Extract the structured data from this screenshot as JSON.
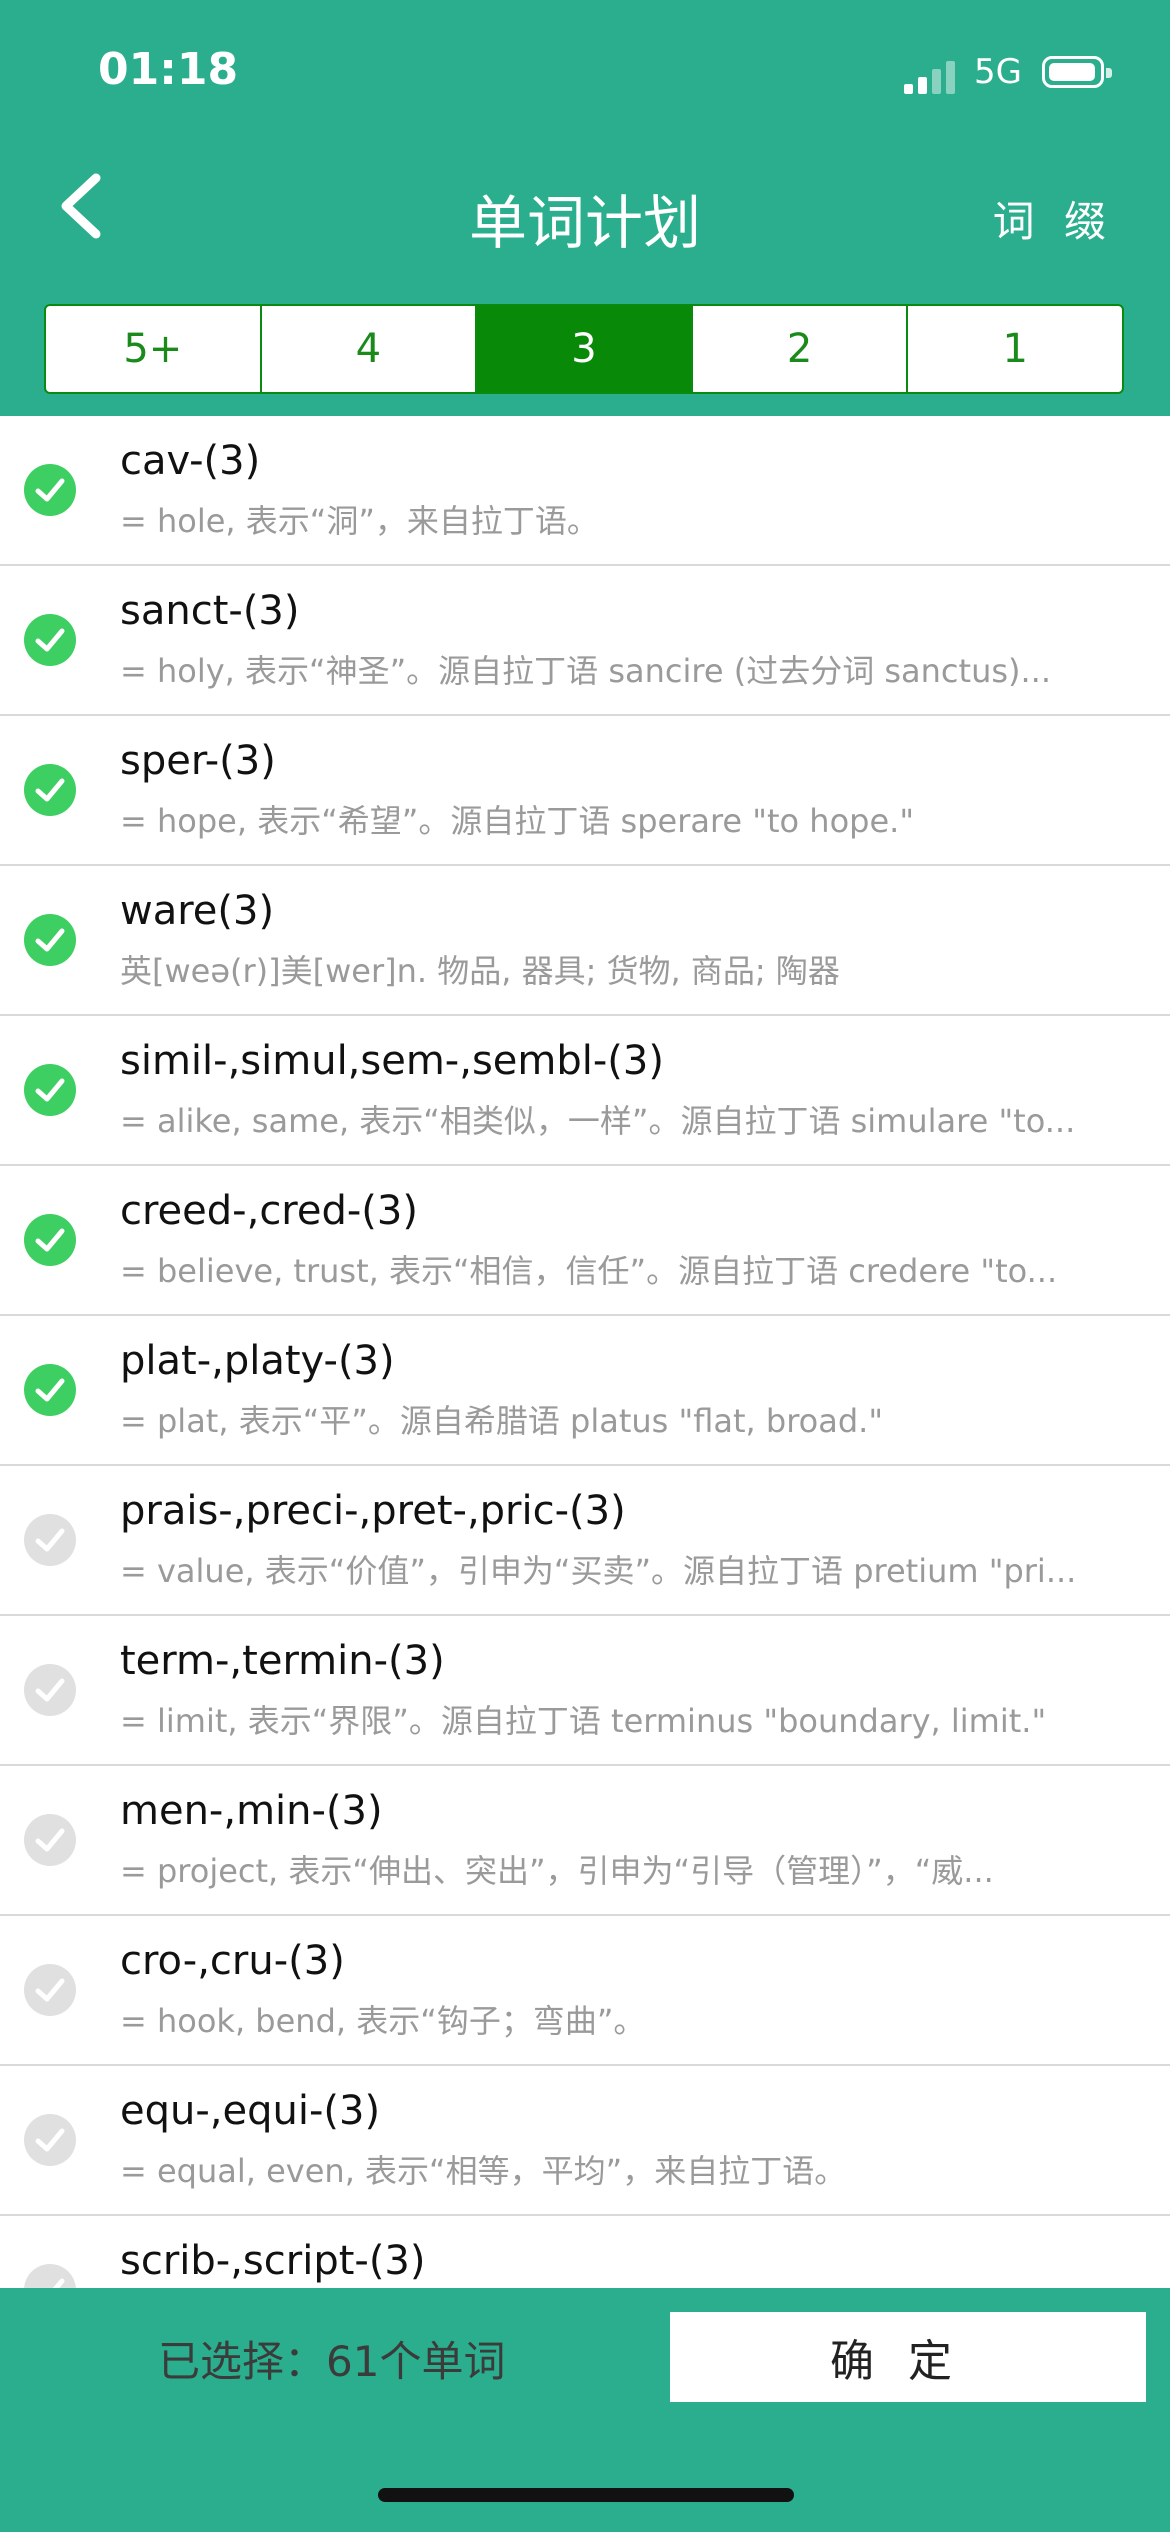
{
  "status_bar": {
    "time": "01:18",
    "network": "5G"
  },
  "header": {
    "title": "单词计划",
    "right_link": "词 缀",
    "segments": [
      "5+",
      "4",
      "3",
      "2",
      "1"
    ],
    "active_segment": "3"
  },
  "words": [
    {
      "word": "cav-(3)",
      "meaning": "= hole, 表示“洞”，来自拉丁语。",
      "checked": true
    },
    {
      "word": "sanct-(3)",
      "meaning": "= holy, 表示“神圣”。源自拉丁语 sancire (过去分词 sanctus)...",
      "checked": true
    },
    {
      "word": "sper-(3)",
      "meaning": "= hope, 表示“希望”。源自拉丁语 sperare \"to hope.\"",
      "checked": true
    },
    {
      "word": "ware(3)",
      "meaning": "英[weə(r)]美[wer]n. 物品, 器具; 货物, 商品; 陶器",
      "checked": true
    },
    {
      "word": "simil-,simul,sem-,sembl-(3)",
      "meaning": "= alike, same, 表示“相类似，一样”。源自拉丁语 simulare \"to...",
      "checked": true
    },
    {
      "word": "creed-,cred-(3)",
      "meaning": "= believe, trust, 表示“相信，信任”。源自拉丁语 credere \"to...",
      "checked": true
    },
    {
      "word": "plat-,platy-(3)",
      "meaning": "= plat, 表示“平”。源自希腊语 platus \"flat, broad.\"",
      "checked": true
    },
    {
      "word": "prais-,preci-,pret-,pric-(3)",
      "meaning": "= value, 表示“价值”，引申为“买卖”。源自拉丁语 pretium \"pri...",
      "checked": false
    },
    {
      "word": "term-,termin-(3)",
      "meaning": "= limit, 表示“界限”。源自拉丁语 terminus \"boundary, limit.\"",
      "checked": false
    },
    {
      "word": "men-,min-(3)",
      "meaning": "= project, 表示“伸出、突出”，引申为“引导（管理）”，“威...",
      "checked": false
    },
    {
      "word": "cro-,cru-(3)",
      "meaning": "= hook, bend, 表示“钩子；弯曲”。",
      "checked": false
    },
    {
      "word": "equ-,equi-(3)",
      "meaning": "= equal, even, 表示“相等，平均”，来自拉丁语。",
      "checked": false
    },
    {
      "word": "scrib-,script-(3)",
      "meaning": "",
      "checked": false
    }
  ],
  "footer": {
    "selected_text": "已选择：61个单词",
    "confirm_label": "确定"
  },
  "colors": {
    "brand": "#2aae8d",
    "active_segment": "#088a08",
    "check_on": "#3ecf62",
    "check_off": "#e0e0e0"
  }
}
